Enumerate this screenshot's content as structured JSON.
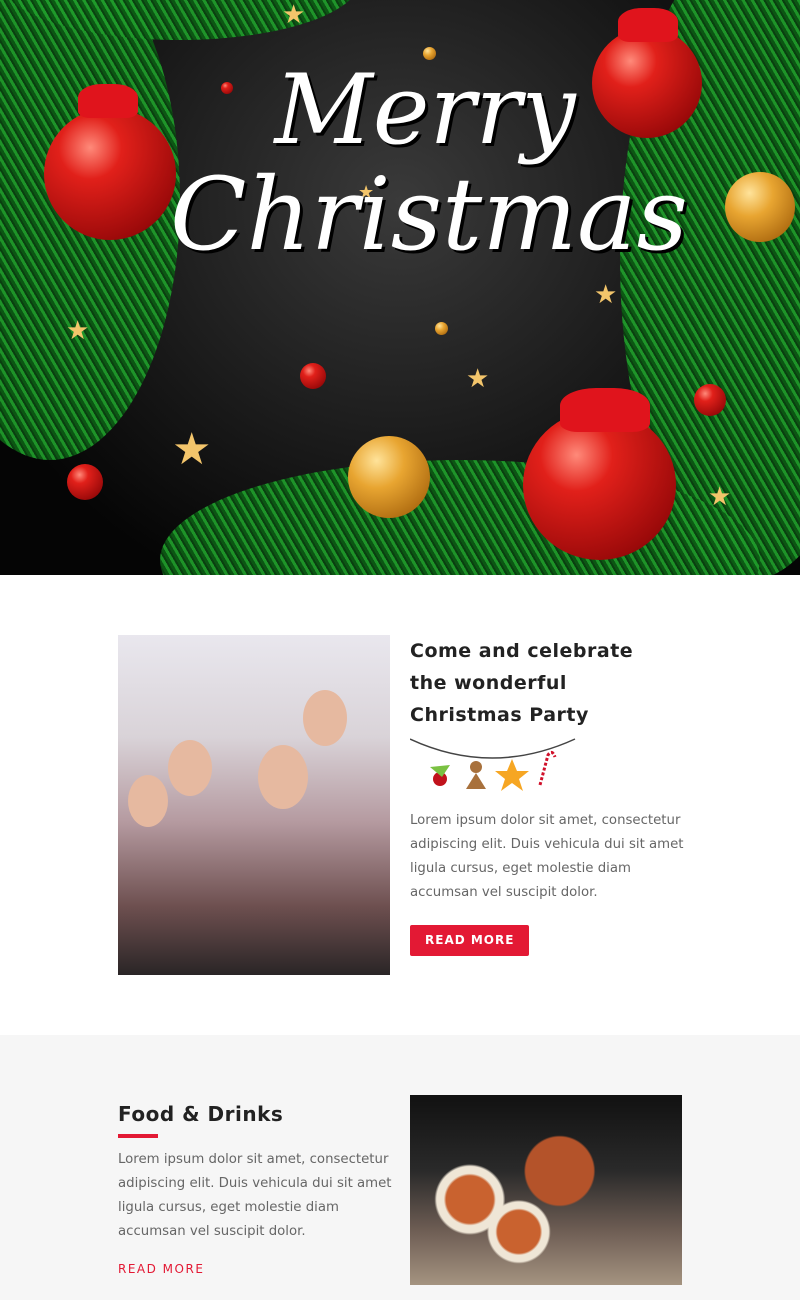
{
  "hero": {
    "title_line1": "Merry",
    "title_line2": "Christmas"
  },
  "party": {
    "title_lines": [
      "Come and celebrate",
      "the wonderful",
      "Christmas Party"
    ],
    "body": "Lorem ipsum dolor sit amet, consectetur adipiscing elit. Duis vehicula dui sit amet ligula cursus, eget molestie diam accumsan vel suscipit dolor.",
    "button": "READ MORE"
  },
  "food": {
    "title": "Food & Drinks",
    "body": "Lorem ipsum dolor sit amet, consectetur adipiscing elit. Duis vehicula dui sit amet ligula cursus, eget molestie diam accumsan vel suscipit dolor.",
    "link": "READ MORE"
  },
  "colors": {
    "accent": "#e31934",
    "section_bg": "#f6f6f6"
  }
}
